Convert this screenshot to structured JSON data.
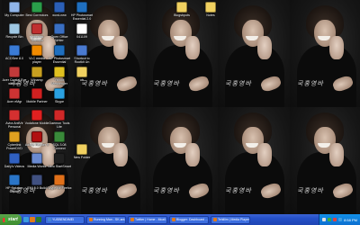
{
  "wallpaper": {
    "signature": "국홍영바",
    "tile_count": 10
  },
  "desktop_icons": [
    {
      "label": "My Computer",
      "icon": "computer-icon",
      "color": "#8fb4e8"
    },
    {
      "label": "Recycle Bin",
      "icon": "recycle-bin-icon",
      "color": "#9ec7e3"
    },
    {
      "label": "ACDSee 8.0",
      "icon": "acdsee-icon",
      "color": "#3a7bd5"
    },
    {
      "label": "Acer Crystal Eye webcam",
      "icon": "webcam-icon",
      "color": "#c23a3a"
    },
    {
      "label": "Acer eMgr",
      "icon": "acer-icon",
      "color": "#cc3333"
    },
    {
      "label": "Avira AntiVir Personal",
      "icon": "avira-icon",
      "color": "#d43030"
    },
    {
      "label": "Cyberlink PowerDVD",
      "icon": "powerdvd-icon",
      "color": "#e0a020"
    },
    {
      "label": "Daily's Videos",
      "icon": "video-icon",
      "color": "#3060c0"
    },
    {
      "label": "HP Solution Center",
      "icon": "hp-icon",
      "color": "#2a75c8"
    },
    {
      "label": "Best Correctors",
      "icon": "app-icon",
      "color": "#2a9d4a"
    },
    {
      "label": "Cyberlink YouCam",
      "icon": "youcam-icon",
      "color": "#c03030"
    },
    {
      "label": "VLC media player",
      "icon": "vlc-icon",
      "color": "#f08a00"
    },
    {
      "label": "Winamp",
      "icon": "winamp-icon",
      "color": "#c8a020"
    },
    {
      "label": "Mobile Partner",
      "icon": "mobile-icon",
      "color": "#d02020"
    },
    {
      "label": "Vodafone Mobile",
      "icon": "vodafone-icon",
      "color": "#e02020"
    },
    {
      "label": "Adobe Reader 9",
      "icon": "pdf-icon",
      "color": "#b01010"
    },
    {
      "label": "Media Works",
      "icon": "media-icon",
      "color": "#6a8ad0"
    },
    {
      "label": "EMI 5.0 Build",
      "icon": "app-icon",
      "color": "#405080"
    },
    {
      "label": "word-new",
      "icon": "word-icon",
      "color": "#2b5fb6"
    },
    {
      "label": "Open Office Writer",
      "icon": "writer-icon",
      "color": "#3a6fc2"
    },
    {
      "label": "HP Photosmart Essential",
      "icon": "hp-photo-icon",
      "color": "#1f6fbf"
    },
    {
      "label": "Yahoo! Messenger",
      "icon": "yahoo-icon",
      "color": "#e0c020"
    },
    {
      "label": "Skype",
      "icon": "skype-icon",
      "color": "#2aa0e0"
    },
    {
      "label": "Daemon Tools Lite",
      "icon": "daemon-icon",
      "color": "#d02828"
    },
    {
      "label": "SQL 3.08 Connect",
      "icon": "sql-icon",
      "color": "#3a8a3a"
    },
    {
      "label": "Nero StartSmart",
      "icon": "nero-icon",
      "color": "#202020"
    },
    {
      "label": "Skype for Firefox",
      "icon": "firefox-icon",
      "color": "#e0701a"
    },
    {
      "label": "HP Photosmart Essential 2.0",
      "icon": "hp-icon",
      "color": "#1f6fbf"
    },
    {
      "label": "041109",
      "icon": "file-icon",
      "color": "#ffffff"
    },
    {
      "label": "Shortcut to Rootkit Un",
      "icon": "shortcut-icon",
      "color": "#4a7ad0"
    },
    {
      "label": "ob",
      "icon": "folder-icon",
      "color": "#f0d060"
    },
    {
      "label": "New Folder",
      "icon": "folder-icon",
      "color": "#f0d060"
    },
    {
      "label": "Blogsbpots",
      "icon": "folder-icon",
      "color": "#f0d060"
    },
    {
      "label": "Notes",
      "icon": "folder-icon",
      "color": "#f0d060"
    }
  ],
  "taskbar": {
    "start_label": "start",
    "tasks": [
      {
        "label": "YUSBENDIMEI",
        "color": "#4a8ad0"
      },
      {
        "label": "Running Man - SK.ant...",
        "color": "#e07a1a"
      },
      {
        "label": "Twitter | Home - Mozil...",
        "color": "#e07a1a"
      },
      {
        "label": "Blogger: Dashboard ...",
        "color": "#e07a1a"
      },
      {
        "label": "Tehillim | Media Player",
        "color": "#e07a1a"
      }
    ],
    "clock": "8:58 PM",
    "quicklaunch_colors": [
      "#3a9be0",
      "#e07a1a",
      "#2a7a2a"
    ],
    "tray_colors": [
      "#e0e0e0",
      "#3ab03a",
      "#e04040",
      "#40a0e0"
    ]
  }
}
